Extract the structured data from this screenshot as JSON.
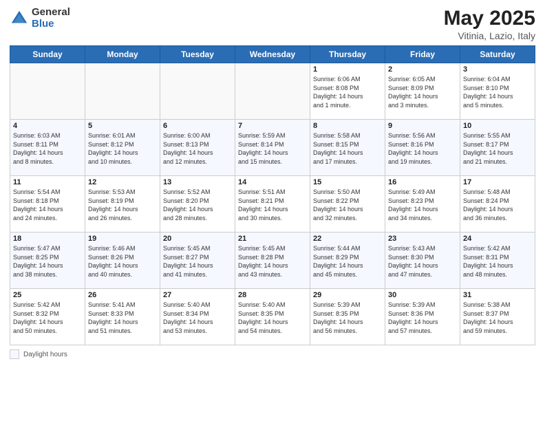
{
  "header": {
    "logo_general": "General",
    "logo_blue": "Blue",
    "title": "May 2025",
    "location": "Vitinia, Lazio, Italy"
  },
  "weekdays": [
    "Sunday",
    "Monday",
    "Tuesday",
    "Wednesday",
    "Thursday",
    "Friday",
    "Saturday"
  ],
  "footer": {
    "label": "Daylight hours"
  },
  "weeks": [
    [
      {
        "day": "",
        "info": ""
      },
      {
        "day": "",
        "info": ""
      },
      {
        "day": "",
        "info": ""
      },
      {
        "day": "",
        "info": ""
      },
      {
        "day": "1",
        "info": "Sunrise: 6:06 AM\nSunset: 8:08 PM\nDaylight: 14 hours\nand 1 minute."
      },
      {
        "day": "2",
        "info": "Sunrise: 6:05 AM\nSunset: 8:09 PM\nDaylight: 14 hours\nand 3 minutes."
      },
      {
        "day": "3",
        "info": "Sunrise: 6:04 AM\nSunset: 8:10 PM\nDaylight: 14 hours\nand 5 minutes."
      }
    ],
    [
      {
        "day": "4",
        "info": "Sunrise: 6:03 AM\nSunset: 8:11 PM\nDaylight: 14 hours\nand 8 minutes."
      },
      {
        "day": "5",
        "info": "Sunrise: 6:01 AM\nSunset: 8:12 PM\nDaylight: 14 hours\nand 10 minutes."
      },
      {
        "day": "6",
        "info": "Sunrise: 6:00 AM\nSunset: 8:13 PM\nDaylight: 14 hours\nand 12 minutes."
      },
      {
        "day": "7",
        "info": "Sunrise: 5:59 AM\nSunset: 8:14 PM\nDaylight: 14 hours\nand 15 minutes."
      },
      {
        "day": "8",
        "info": "Sunrise: 5:58 AM\nSunset: 8:15 PM\nDaylight: 14 hours\nand 17 minutes."
      },
      {
        "day": "9",
        "info": "Sunrise: 5:56 AM\nSunset: 8:16 PM\nDaylight: 14 hours\nand 19 minutes."
      },
      {
        "day": "10",
        "info": "Sunrise: 5:55 AM\nSunset: 8:17 PM\nDaylight: 14 hours\nand 21 minutes."
      }
    ],
    [
      {
        "day": "11",
        "info": "Sunrise: 5:54 AM\nSunset: 8:18 PM\nDaylight: 14 hours\nand 24 minutes."
      },
      {
        "day": "12",
        "info": "Sunrise: 5:53 AM\nSunset: 8:19 PM\nDaylight: 14 hours\nand 26 minutes."
      },
      {
        "day": "13",
        "info": "Sunrise: 5:52 AM\nSunset: 8:20 PM\nDaylight: 14 hours\nand 28 minutes."
      },
      {
        "day": "14",
        "info": "Sunrise: 5:51 AM\nSunset: 8:21 PM\nDaylight: 14 hours\nand 30 minutes."
      },
      {
        "day": "15",
        "info": "Sunrise: 5:50 AM\nSunset: 8:22 PM\nDaylight: 14 hours\nand 32 minutes."
      },
      {
        "day": "16",
        "info": "Sunrise: 5:49 AM\nSunset: 8:23 PM\nDaylight: 14 hours\nand 34 minutes."
      },
      {
        "day": "17",
        "info": "Sunrise: 5:48 AM\nSunset: 8:24 PM\nDaylight: 14 hours\nand 36 minutes."
      }
    ],
    [
      {
        "day": "18",
        "info": "Sunrise: 5:47 AM\nSunset: 8:25 PM\nDaylight: 14 hours\nand 38 minutes."
      },
      {
        "day": "19",
        "info": "Sunrise: 5:46 AM\nSunset: 8:26 PM\nDaylight: 14 hours\nand 40 minutes."
      },
      {
        "day": "20",
        "info": "Sunrise: 5:45 AM\nSunset: 8:27 PM\nDaylight: 14 hours\nand 41 minutes."
      },
      {
        "day": "21",
        "info": "Sunrise: 5:45 AM\nSunset: 8:28 PM\nDaylight: 14 hours\nand 43 minutes."
      },
      {
        "day": "22",
        "info": "Sunrise: 5:44 AM\nSunset: 8:29 PM\nDaylight: 14 hours\nand 45 minutes."
      },
      {
        "day": "23",
        "info": "Sunrise: 5:43 AM\nSunset: 8:30 PM\nDaylight: 14 hours\nand 47 minutes."
      },
      {
        "day": "24",
        "info": "Sunrise: 5:42 AM\nSunset: 8:31 PM\nDaylight: 14 hours\nand 48 minutes."
      }
    ],
    [
      {
        "day": "25",
        "info": "Sunrise: 5:42 AM\nSunset: 8:32 PM\nDaylight: 14 hours\nand 50 minutes."
      },
      {
        "day": "26",
        "info": "Sunrise: 5:41 AM\nSunset: 8:33 PM\nDaylight: 14 hours\nand 51 minutes."
      },
      {
        "day": "27",
        "info": "Sunrise: 5:40 AM\nSunset: 8:34 PM\nDaylight: 14 hours\nand 53 minutes."
      },
      {
        "day": "28",
        "info": "Sunrise: 5:40 AM\nSunset: 8:35 PM\nDaylight: 14 hours\nand 54 minutes."
      },
      {
        "day": "29",
        "info": "Sunrise: 5:39 AM\nSunset: 8:35 PM\nDaylight: 14 hours\nand 56 minutes."
      },
      {
        "day": "30",
        "info": "Sunrise: 5:39 AM\nSunset: 8:36 PM\nDaylight: 14 hours\nand 57 minutes."
      },
      {
        "day": "31",
        "info": "Sunrise: 5:38 AM\nSunset: 8:37 PM\nDaylight: 14 hours\nand 59 minutes."
      }
    ]
  ]
}
